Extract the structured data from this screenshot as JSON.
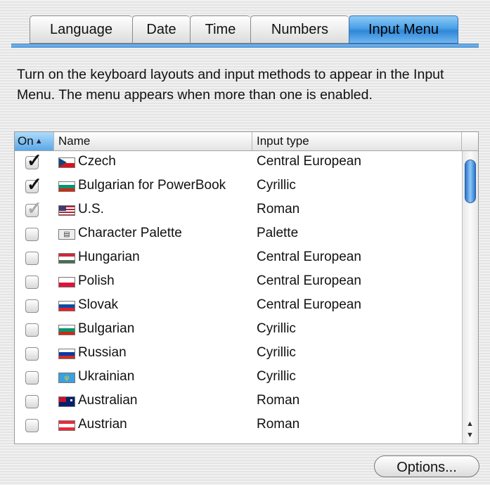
{
  "tabs": [
    {
      "label": "Language",
      "active": false
    },
    {
      "label": "Date",
      "active": false
    },
    {
      "label": "Time",
      "active": false
    },
    {
      "label": "Numbers",
      "active": false
    },
    {
      "label": "Input Menu",
      "active": true
    }
  ],
  "description": "Turn on the keyboard layouts and input methods to appear in the Input Menu. The menu appears when more than one is enabled.",
  "table": {
    "columns": {
      "on": "On",
      "name": "Name",
      "type": "Input type"
    },
    "sort_indicator": "▲",
    "rows": [
      {
        "checked": true,
        "dim": false,
        "name": "Czech",
        "type": "Central European",
        "icon": "czech-flag-icon"
      },
      {
        "checked": true,
        "dim": false,
        "name": "Bulgarian for PowerBook",
        "type": "Cyrillic",
        "icon": "bulgarian-flag-icon"
      },
      {
        "checked": true,
        "dim": true,
        "name": "U.S.",
        "type": "Roman",
        "icon": "us-flag-icon"
      },
      {
        "checked": false,
        "dim": false,
        "name": "Character Palette",
        "type": "Palette",
        "icon": "character-palette-icon"
      },
      {
        "checked": false,
        "dim": false,
        "name": "Hungarian",
        "type": "Central European",
        "icon": "hungarian-flag-icon"
      },
      {
        "checked": false,
        "dim": false,
        "name": "Polish",
        "type": "Central European",
        "icon": "polish-flag-icon"
      },
      {
        "checked": false,
        "dim": false,
        "name": "Slovak",
        "type": "Central European",
        "icon": "slovak-flag-icon"
      },
      {
        "checked": false,
        "dim": false,
        "name": "Bulgarian",
        "type": "Cyrillic",
        "icon": "bulgarian-flag-icon"
      },
      {
        "checked": false,
        "dim": false,
        "name": "Russian",
        "type": "Cyrillic",
        "icon": "russian-flag-icon"
      },
      {
        "checked": false,
        "dim": false,
        "name": "Ukrainian",
        "type": "Cyrillic",
        "icon": "ukrainian-flag-icon"
      },
      {
        "checked": false,
        "dim": false,
        "name": "Australian",
        "type": "Roman",
        "icon": "australian-flag-icon"
      },
      {
        "checked": false,
        "dim": false,
        "name": "Austrian",
        "type": "Roman",
        "icon": "austrian-flag-icon"
      }
    ]
  },
  "options_label": "Options...",
  "colors": {
    "accent": "#4aa0e6",
    "selection": "#5aa8e8"
  }
}
